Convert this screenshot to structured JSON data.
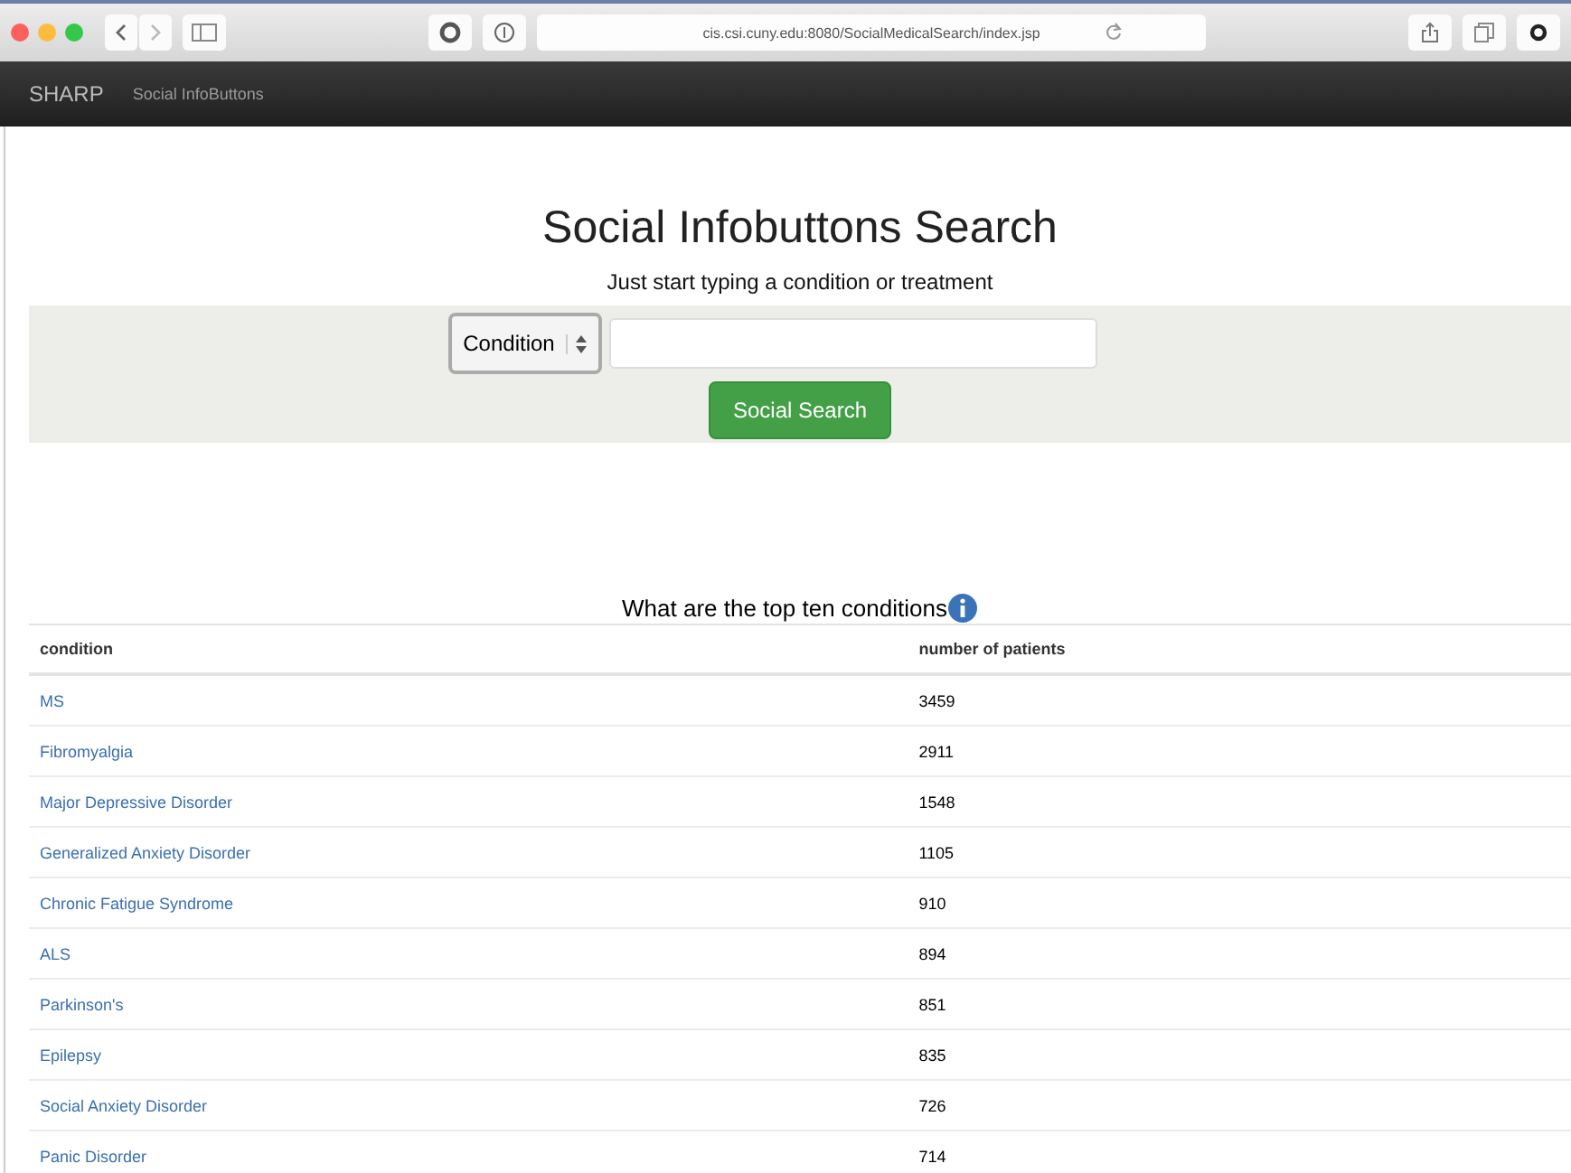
{
  "browser": {
    "url": "cis.csi.cuny.edu:8080/SocialMedicalSearch/index.jsp"
  },
  "navbar": {
    "brand": "SHARP",
    "links": [
      "Social InfoButtons"
    ]
  },
  "heading": "Social Infobuttons Search",
  "subheading": "Just start typing a condition or treatment",
  "search": {
    "select_value": "Condition",
    "button": "Social Search"
  },
  "table": {
    "caption": "What are the top ten conditions",
    "columns": [
      "condition",
      "number of patients"
    ],
    "rows": [
      {
        "condition": "MS",
        "count": "3459"
      },
      {
        "condition": "Fibromyalgia",
        "count": "2911"
      },
      {
        "condition": "Major Depressive Disorder",
        "count": "1548"
      },
      {
        "condition": "Generalized Anxiety Disorder",
        "count": "1105"
      },
      {
        "condition": "Chronic Fatigue Syndrome",
        "count": "910"
      },
      {
        "condition": "ALS",
        "count": "894"
      },
      {
        "condition": "Parkinson's",
        "count": "851"
      },
      {
        "condition": "Epilepsy",
        "count": "835"
      },
      {
        "condition": "Social Anxiety Disorder",
        "count": "726"
      },
      {
        "condition": "Panic Disorder",
        "count": "714"
      }
    ]
  }
}
